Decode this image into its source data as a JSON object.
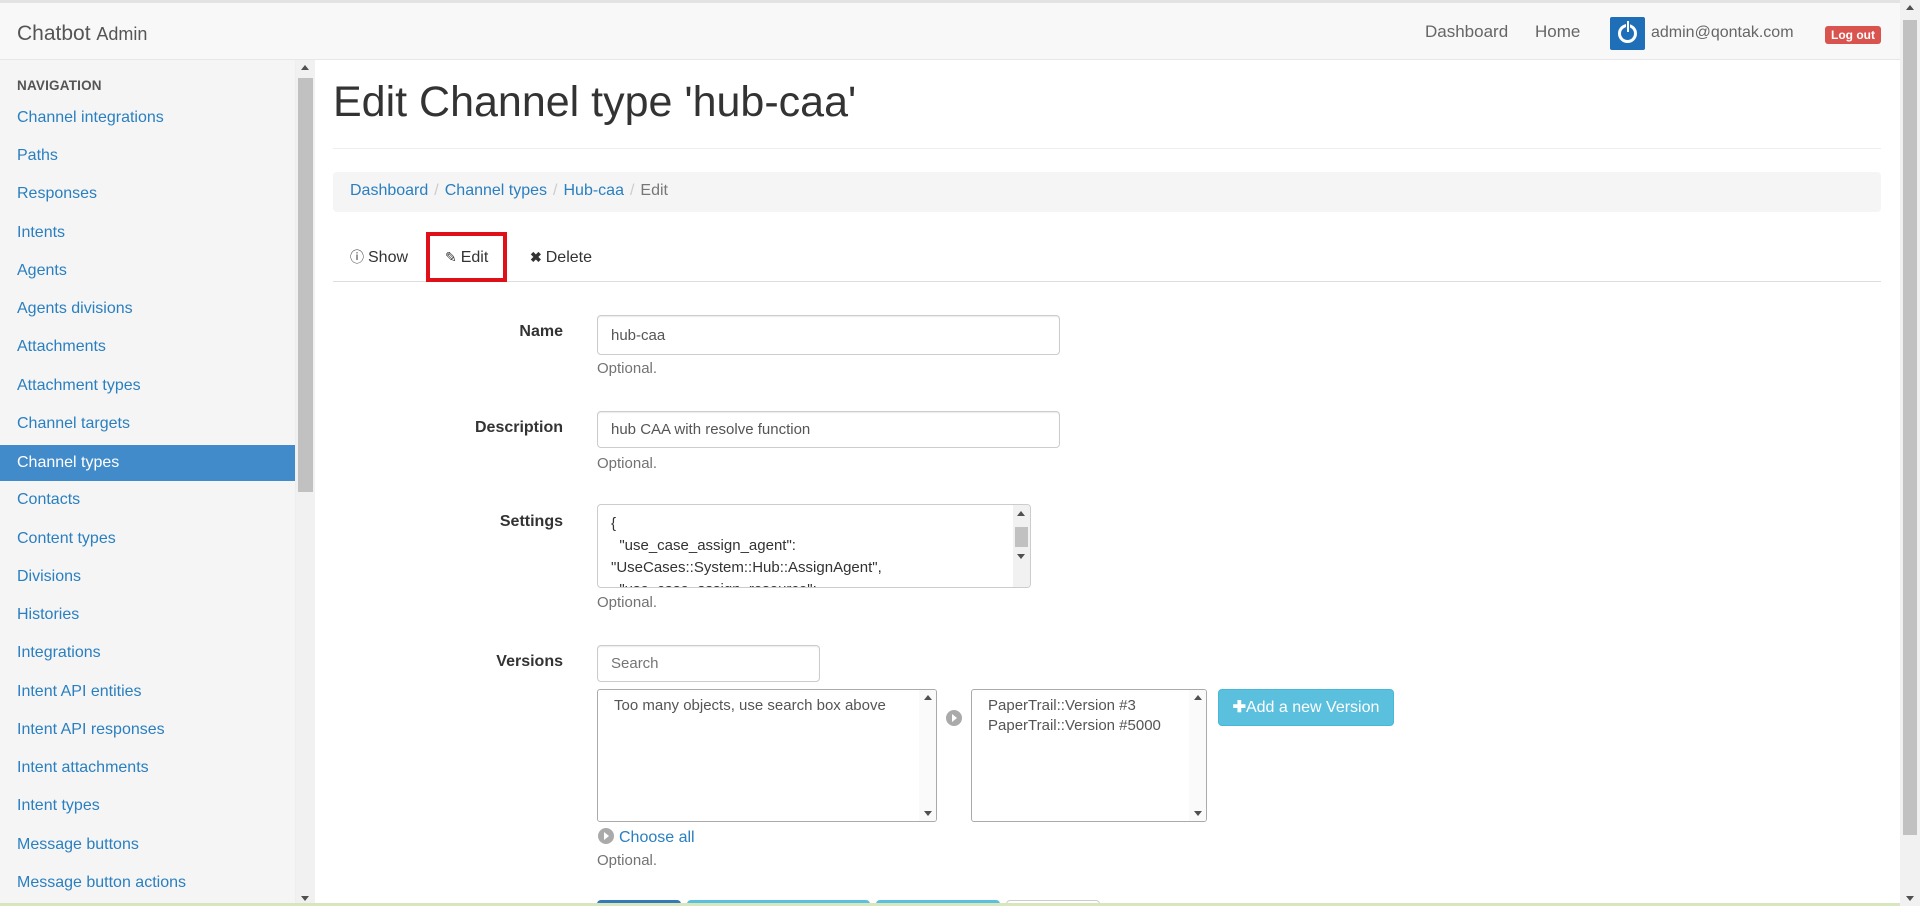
{
  "navbar": {
    "brand_main": "Chatbot",
    "brand_sub": "Admin",
    "links": [
      "Dashboard",
      "Home"
    ],
    "user_email": "admin@qontak.com",
    "logout_label": "Log out"
  },
  "sidebar": {
    "header": "NAVIGATION",
    "items": [
      "Channel integrations",
      "Paths",
      "Responses",
      "Intents",
      "Agents",
      "Agents divisions",
      "Attachments",
      "Attachment types",
      "Channel targets",
      "Channel types",
      "Contacts",
      "Content types",
      "Divisions",
      "Histories",
      "Integrations",
      "Intent API entities",
      "Intent API responses",
      "Intent attachments",
      "Intent types",
      "Message buttons",
      "Message button actions"
    ],
    "active_item": "Channel types"
  },
  "page": {
    "title": "Edit Channel type 'hub-caa'"
  },
  "breadcrumb": {
    "items": [
      "Dashboard",
      "Channel types",
      "Hub-caa"
    ],
    "current": "Edit"
  },
  "tabs": {
    "show": "Show",
    "edit": "Edit",
    "delete": "Delete"
  },
  "form": {
    "name_label": "Name",
    "name_value": "hub-caa",
    "name_help": "Optional.",
    "description_label": "Description",
    "description_value": "hub CAA with resolve function",
    "description_help": "Optional.",
    "settings_label": "Settings",
    "settings_value": "{\n  \"use_case_assign_agent\":\n\"UseCases::System::Hub::AssignAgent\",\n  \"use_case_assign_resource\":",
    "settings_help": "Optional.",
    "versions_label": "Versions",
    "versions_search_placeholder": "Search",
    "versions_available_text": "Too many objects, use search box above",
    "versions_selected": [
      "PaperTrail::Version #3",
      "PaperTrail::Version #5000"
    ],
    "add_version_label": "Add a new Version",
    "choose_all_label": "Choose all",
    "versions_help": "Optional."
  }
}
